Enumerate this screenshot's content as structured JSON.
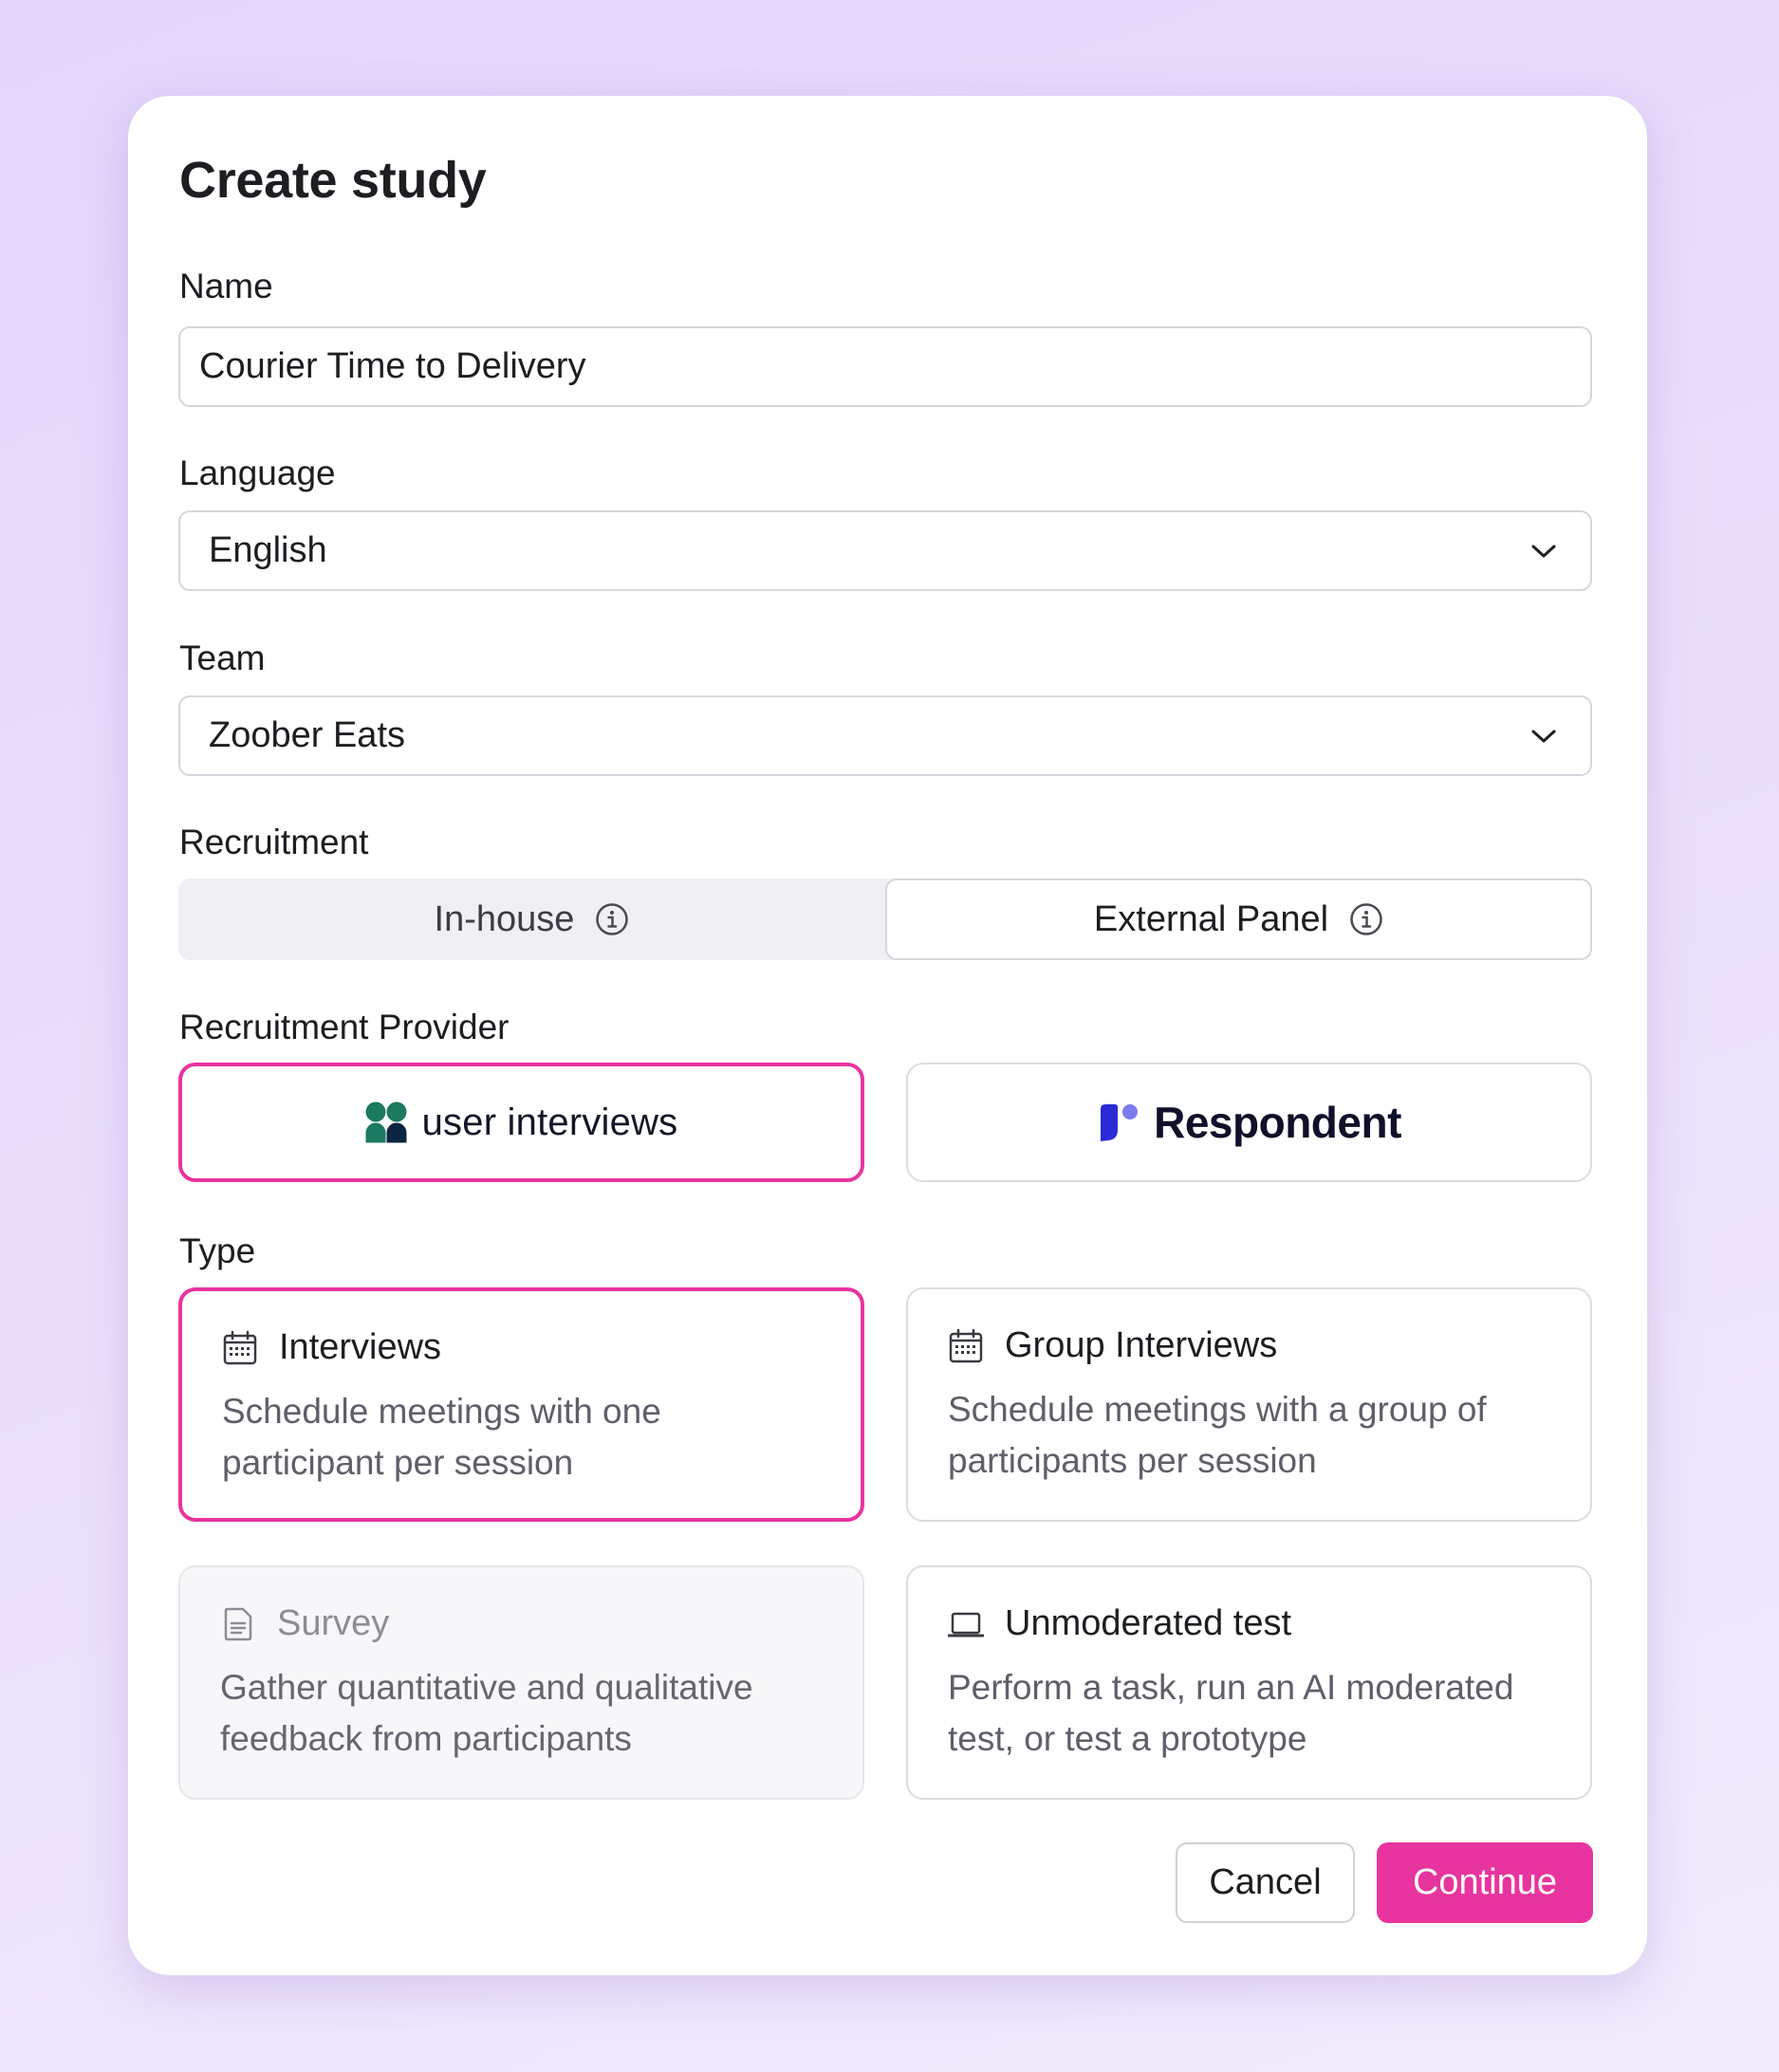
{
  "dialog": {
    "title": "Create study",
    "cancel_label": "Cancel",
    "continue_label": "Continue"
  },
  "fields": {
    "name": {
      "label": "Name",
      "value": "Courier Time to Delivery"
    },
    "language": {
      "label": "Language",
      "value": "English"
    },
    "team": {
      "label": "Team",
      "value": "Zoober Eats"
    }
  },
  "recruitment": {
    "label": "Recruitment",
    "options": [
      {
        "label": "In-house",
        "icon": "info-icon",
        "selected": false
      },
      {
        "label": "External Panel",
        "icon": "info-icon",
        "selected": true
      }
    ]
  },
  "provider": {
    "label": "Recruitment Provider",
    "options": [
      {
        "name": "user interviews",
        "logo": "user-interviews-logo",
        "selected": true
      },
      {
        "name": "Respondent",
        "logo": "respondent-logo",
        "selected": false
      }
    ]
  },
  "type": {
    "label": "Type",
    "options": [
      {
        "title": "Interviews",
        "description": "Schedule meetings with one participant per session",
        "icon": "calendar-icon",
        "selected": true,
        "disabled": false
      },
      {
        "title": "Group Interviews",
        "description": "Schedule meetings with a group of participants per session",
        "icon": "calendar-icon",
        "selected": false,
        "disabled": false
      },
      {
        "title": "Survey",
        "description": "Gather quantitative and qualitative feedback from participants",
        "icon": "document-icon",
        "selected": false,
        "disabled": true
      },
      {
        "title": "Unmoderated test",
        "description": "Perform a task, run an AI moderated test, or test a prototype",
        "icon": "laptop-icon",
        "selected": false,
        "disabled": false
      }
    ]
  },
  "colors": {
    "accent": "#e8349e",
    "background": "#e3d6fb",
    "border": "#d6d6dd",
    "segment_bg": "#efeff4",
    "ui_logo_green": "#1b7a5f",
    "ui_logo_dark": "#0b2540",
    "respondent_logo": "#2a2ad6"
  }
}
